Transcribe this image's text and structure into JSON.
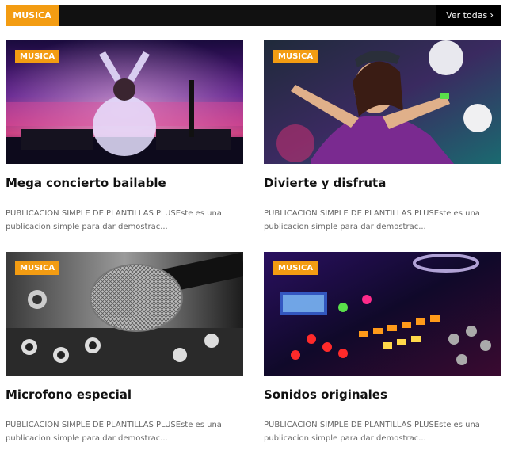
{
  "section": {
    "tab_label": "MUSICA",
    "see_all_label": "Ver todas",
    "accent_color": "#f39c12"
  },
  "posts": [
    {
      "category": "MUSICA",
      "title": "Mega concierto bailable",
      "excerpt_line1": "PUBLICACION SIMPLE DE PLANTILLAS PLUSEste es una",
      "excerpt_line2": "publicacion simple para dar demostrac..."
    },
    {
      "category": "MUSICA",
      "title": "Divierte y disfruta",
      "excerpt_line1": "PUBLICACION SIMPLE DE PLANTILLAS PLUSEste es una",
      "excerpt_line2": "publicacion simple para dar demostrac..."
    },
    {
      "category": "MUSICA",
      "title": "Microfono especial",
      "excerpt_line1": "PUBLICACION SIMPLE DE PLANTILLAS PLUSEste es una",
      "excerpt_line2": "publicacion simple para dar demostrac..."
    },
    {
      "category": "MUSICA",
      "title": "Sonidos originales",
      "excerpt_line1": "PUBLICACION SIMPLE DE PLANTILLAS PLUSEste es una",
      "excerpt_line2": "publicacion simple para dar demostrac..."
    }
  ]
}
